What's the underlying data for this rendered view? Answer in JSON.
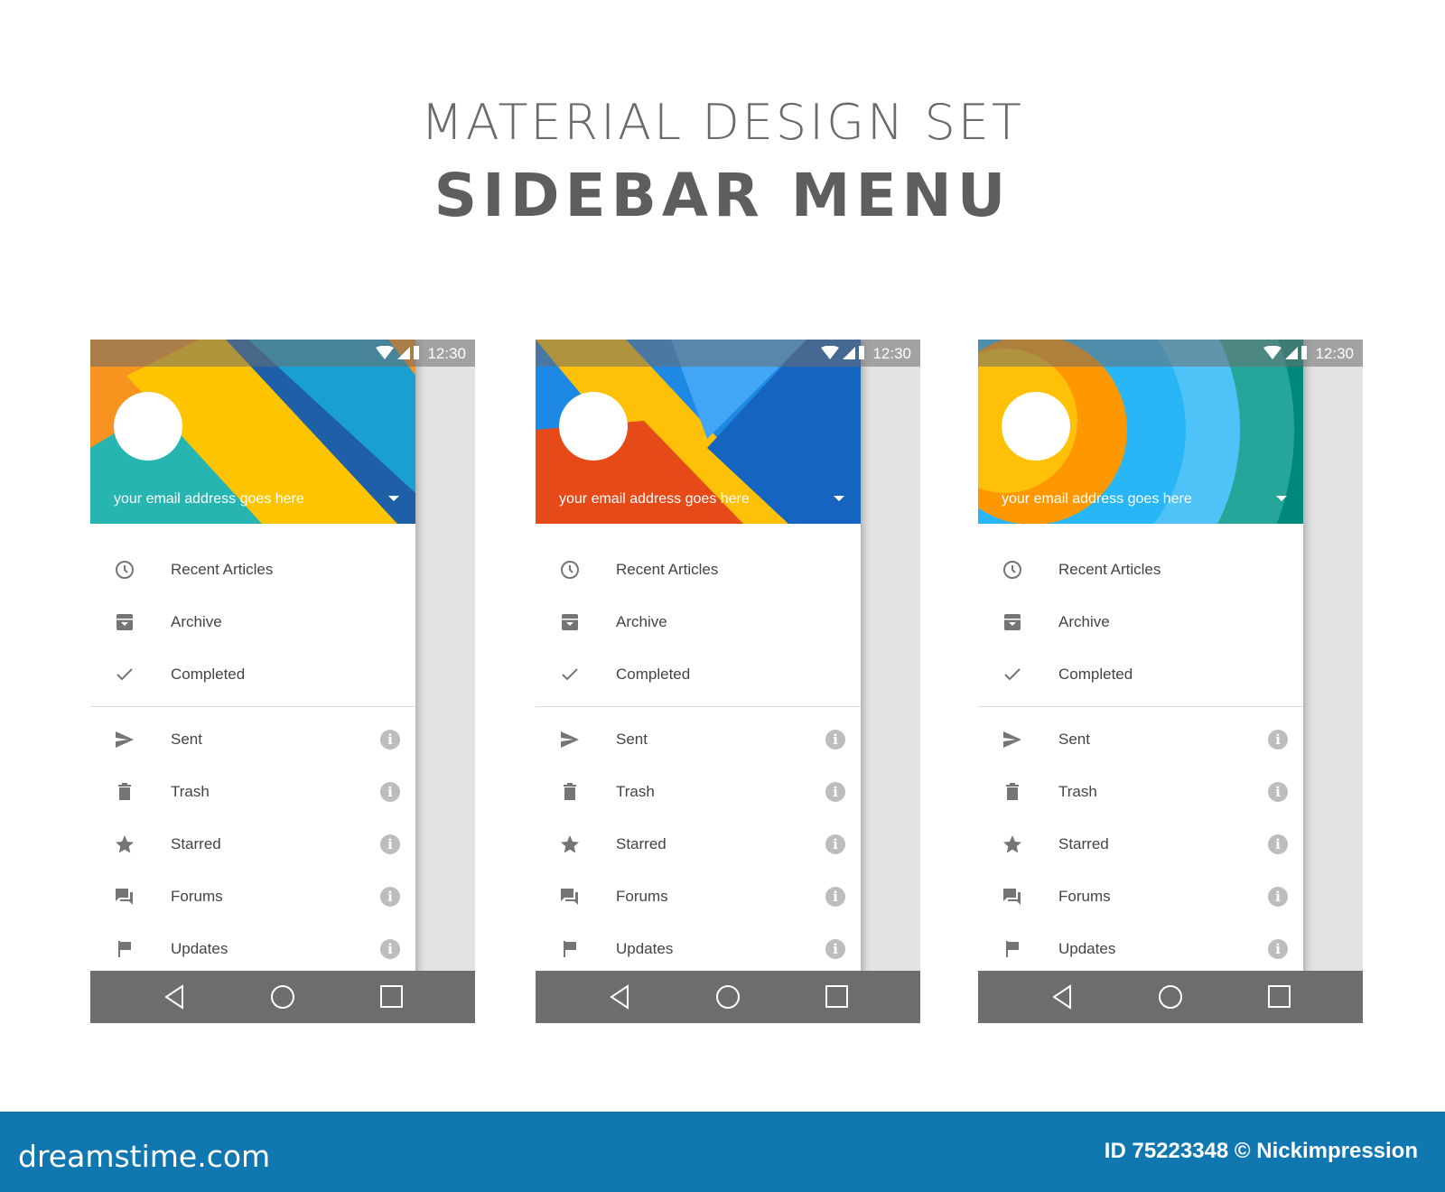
{
  "title": {
    "line1": "MATERIAL DESIGN SET",
    "line2": "SIDEBAR MENU"
  },
  "phones": [
    {
      "theme": "orange-yellow-blue-stripes",
      "colors": [
        "#f7931e",
        "#ffc400",
        "#1aa0d0",
        "#1e5fa8",
        "#26b5b0"
      ]
    },
    {
      "theme": "blue-yellow-red-diagonals",
      "colors": [
        "#1e88e5",
        "#ffc107",
        "#e64a19",
        "#1565c0",
        "#42a5f5"
      ]
    },
    {
      "theme": "orange-teal-circles",
      "colors": [
        "#ff9800",
        "#ffc107",
        "#29b6f6",
        "#00897b",
        "#26a69a"
      ]
    }
  ],
  "status": {
    "time": "12:30",
    "icons": [
      "wifi-icon",
      "signal-icon",
      "battery-icon"
    ]
  },
  "email": "your email address goes here",
  "menu_top": [
    {
      "label": "Recent Articles",
      "icon": "clock-icon"
    },
    {
      "label": "Archive",
      "icon": "archive-icon"
    },
    {
      "label": "Completed",
      "icon": "check-icon"
    }
  ],
  "menu_bottom": [
    {
      "label": "Sent",
      "icon": "send-icon"
    },
    {
      "label": "Trash",
      "icon": "trash-icon"
    },
    {
      "label": "Starred",
      "icon": "star-icon"
    },
    {
      "label": "Forums",
      "icon": "forum-icon"
    },
    {
      "label": "Updates",
      "icon": "flag-icon"
    }
  ],
  "info_glyph": "i",
  "nav": [
    "back-icon",
    "home-icon",
    "recents-icon"
  ],
  "footer": {
    "logo": "dreamstime.com",
    "credit": "ID 75223348 © Nickimpression"
  }
}
